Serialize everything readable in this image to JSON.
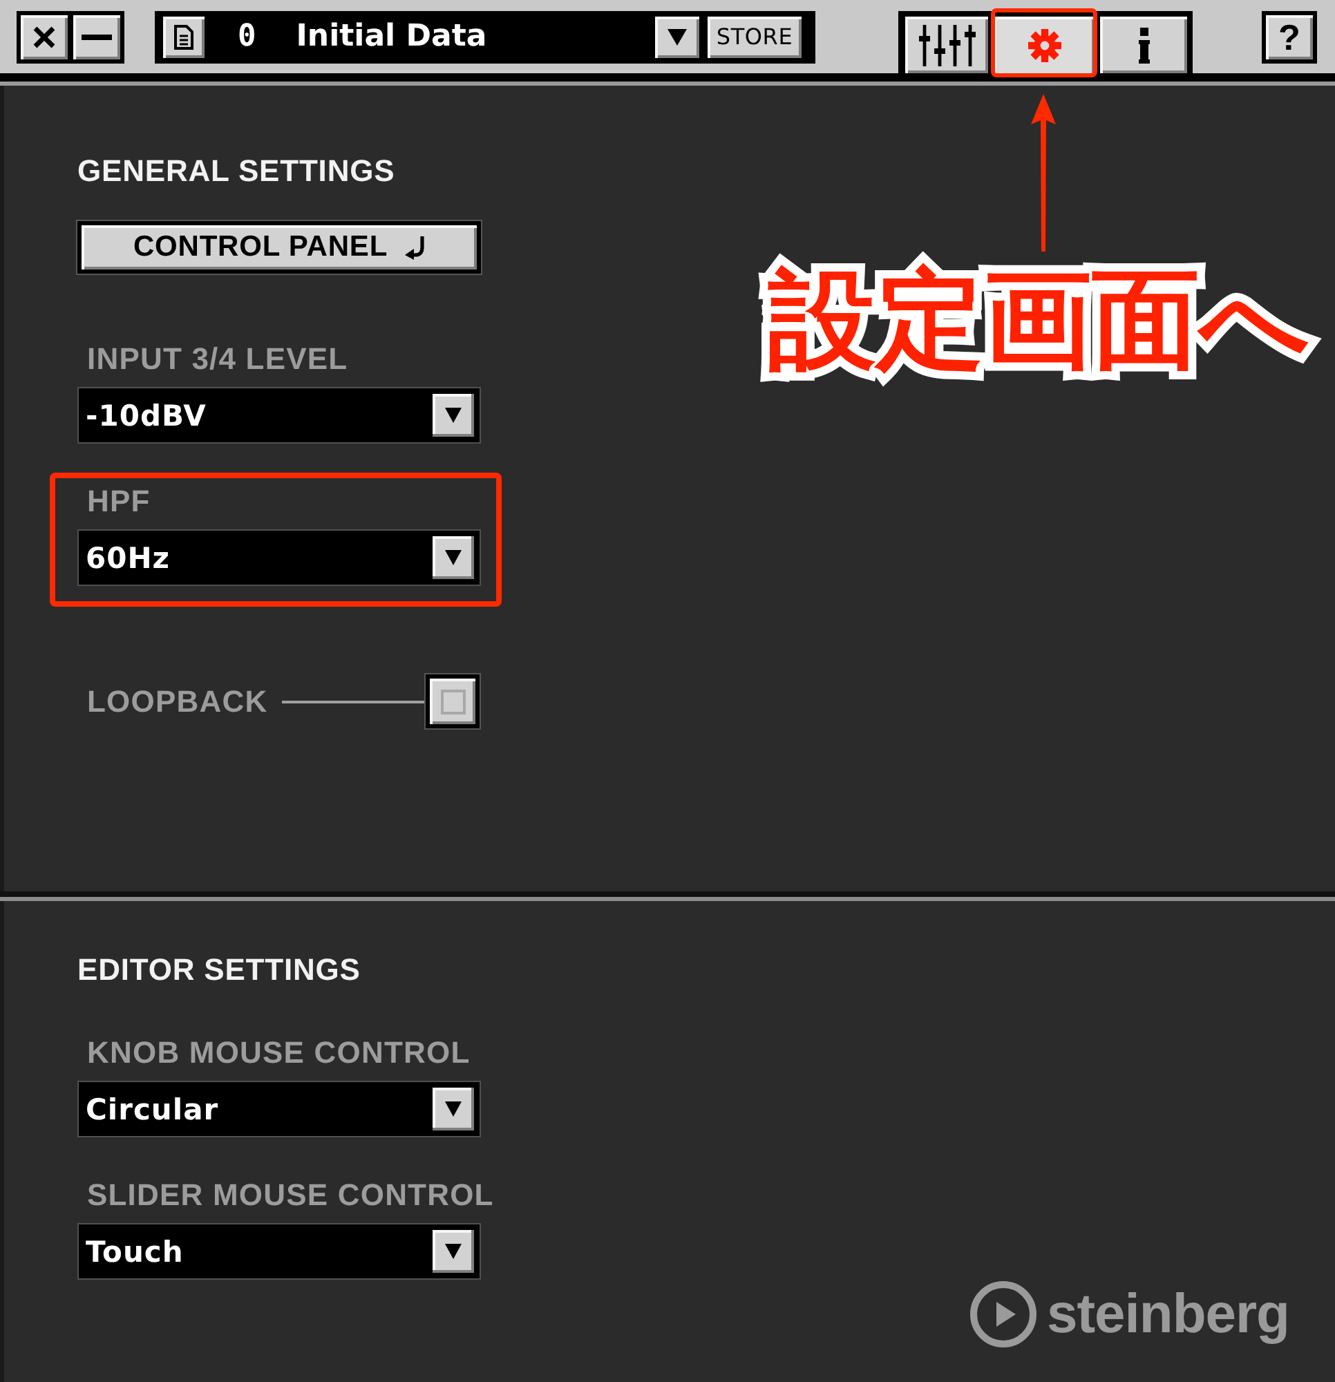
{
  "toolbar": {
    "window_buttons": [
      {
        "kind": "close"
      },
      {
        "kind": "minimize"
      }
    ],
    "preset": {
      "number": "0",
      "name": "Initial Data"
    },
    "store_button": "STORE",
    "tabs": [
      {
        "kind": "mixer",
        "selected": false
      },
      {
        "kind": "settings",
        "selected": true,
        "highlighted": true
      },
      {
        "kind": "info",
        "selected": false
      }
    ],
    "help_button": "?"
  },
  "sections": [
    {
      "title": "GENERAL SETTINGS",
      "controls": [
        {
          "kind": "button",
          "label": "CONTROL PANEL"
        },
        {
          "kind": "dropdown",
          "label": "INPUT 3/4 LEVEL",
          "value": "-10dBV"
        },
        {
          "kind": "dropdown",
          "label": "HPF",
          "value": "60Hz",
          "highlighted": true
        },
        {
          "kind": "checkbox",
          "label": "LOOPBACK",
          "checked": false
        }
      ]
    },
    {
      "title": "EDITOR SETTINGS",
      "controls": [
        {
          "kind": "dropdown",
          "label": "KNOB MOUSE CONTROL",
          "value": "Circular"
        },
        {
          "kind": "dropdown",
          "label": "SLIDER MOUSE CONTROL",
          "value": "Touch"
        }
      ]
    }
  ],
  "logo": {
    "text": "steinberg"
  },
  "callout": {
    "text": "設定画面へ"
  }
}
